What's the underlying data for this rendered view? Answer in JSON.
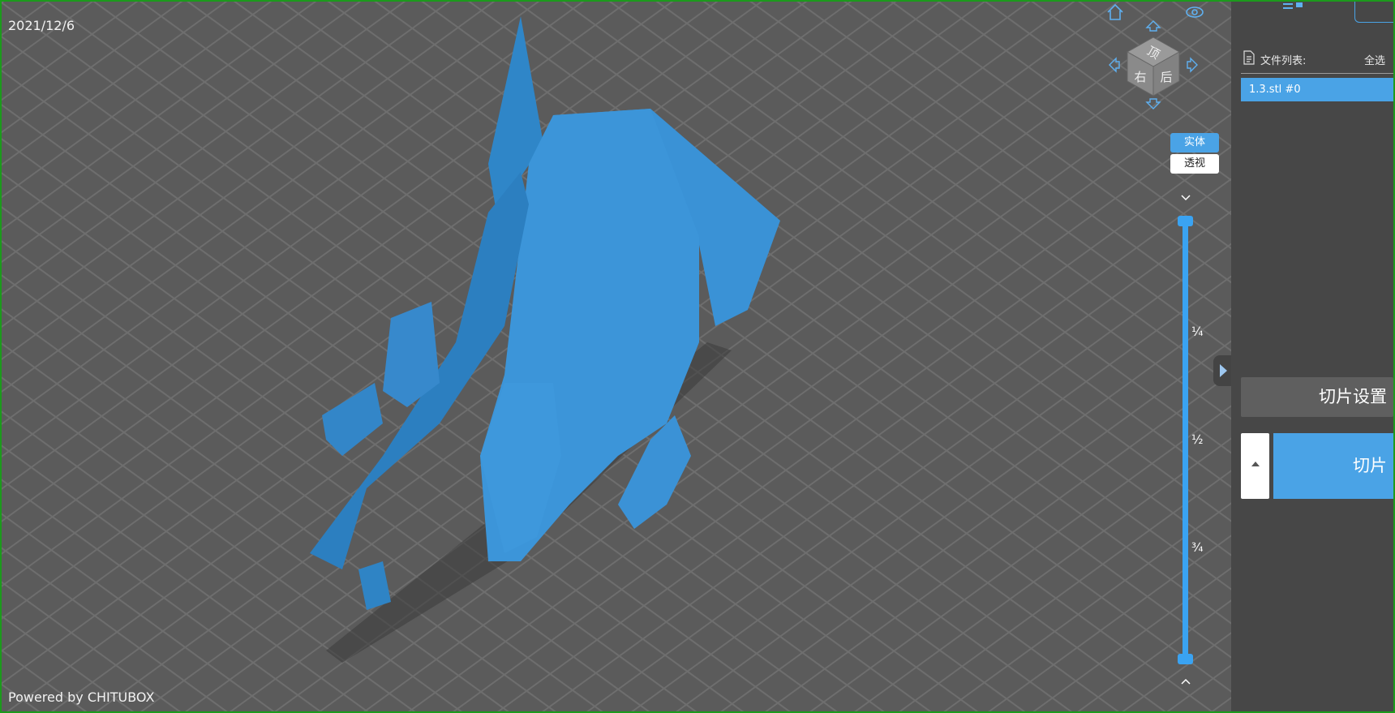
{
  "viewport": {
    "date": "2021/12/6",
    "powered_by": "Powered by CHITUBOX",
    "model_color": "#3a8fd4"
  },
  "view_cube": {
    "faces": {
      "top": "顶",
      "right": "右",
      "back": "后"
    },
    "icons": [
      "home-icon",
      "eye-icon",
      "arrow-up-icon",
      "arrow-left-icon",
      "arrow-right-icon",
      "arrow-down-icon"
    ]
  },
  "render_modes": {
    "solid": "实体",
    "xray": "透视",
    "active": "solid"
  },
  "layer_slider": {
    "ticks": [
      "¼",
      "½",
      "¾"
    ],
    "color": "#3aa3f2"
  },
  "sidebar": {
    "file_list_label": "文件列表:",
    "select_all": "全选",
    "files": [
      "1.3.stl #0"
    ],
    "slice_settings_label": "切片设置",
    "slice_label": "切片",
    "accent": "#4aa3e6"
  }
}
